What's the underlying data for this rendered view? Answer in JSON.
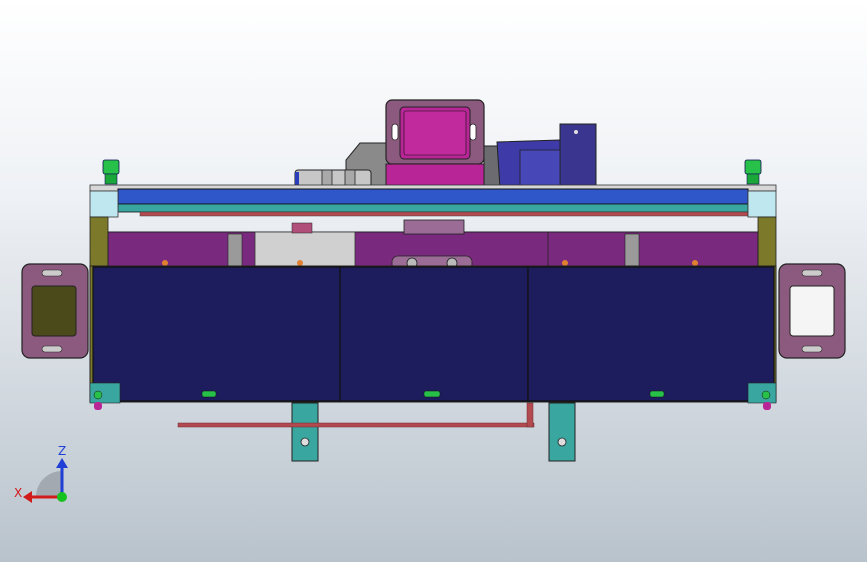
{
  "viewport": {
    "background_top": "#ffffff",
    "background_bottom": "#b9c3cc"
  },
  "triad": {
    "z_label": "Z",
    "x_label": "X",
    "z_color": "#1f3fd6",
    "x_color": "#d11a1a",
    "y_color": "#16c21f"
  },
  "model": {
    "description_hidden": true,
    "colors": {
      "frame_blue": "#1d1c5c",
      "plate_blue": "#2f57c9",
      "purple": "#7a2a7e",
      "magenta": "#b82596",
      "teal": "#3aa6a0",
      "olive": "#7c7a2a",
      "lavender": "#8c5a7f",
      "gray": "#c9c9c9",
      "red_rod": "#b24a50",
      "green_cap": "#27c14a"
    }
  }
}
